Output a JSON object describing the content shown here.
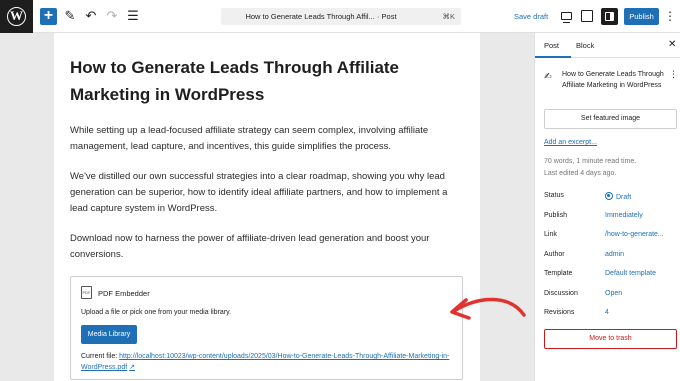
{
  "topbar": {
    "logo_letter": "W",
    "add_icon": "+",
    "pen_icon": "✎",
    "undo_icon": "↶",
    "redo_icon": "↷",
    "list_icon": "☰",
    "command_title": "How to Generate Leads Through Affil... · Post",
    "command_shortcut": "⌘K",
    "save_draft": "Save draft",
    "publish": "Publish",
    "more_icon": "⋮"
  },
  "editor": {
    "title": "How to Generate Leads Through Affiliate Marketing in WordPress",
    "paragraphs": [
      "While setting up a lead-focused affiliate strategy can seem complex, involving affiliate management, lead capture, and incentives, this guide simplifies the process.",
      "We've distilled our own successful strategies into a clear roadmap, showing you why lead generation can be superior, how to identify ideal affiliate partners, and how to implement a lead capture system in WordPress.",
      "Download now to harness the power of affiliate-driven lead generation and boost your conversions."
    ],
    "pdf_block": {
      "icon_text": "PDF",
      "title": "PDF Embedder",
      "description": "Upload a file or pick one from your media library.",
      "button": "Media Library",
      "current_file_label": "Current file: ",
      "current_file_link": "http://localhost:10023/wp-content/uploads/2025/03/How-to-Generate-Leads-Through-Affiliate-Marketing-in-WordPress.pdf",
      "external_icon": "↗"
    }
  },
  "annotation": {
    "arrow_color": "#e0332e"
  },
  "sidebar": {
    "tabs": [
      "Post",
      "Block"
    ],
    "close_icon": "✕",
    "doc_icon": "✍",
    "doc_title": "How to Generate Leads Through Affiliate Marketing in WordPress",
    "doc_more": "⋮",
    "featured_image": "Set featured image",
    "add_excerpt": "Add an excerpt...",
    "word_count": "70 words, 1 minute read time.",
    "last_edited": "Last edited 4 days ago.",
    "rows": [
      {
        "label": "Status",
        "value": "Draft"
      },
      {
        "label": "Publish",
        "value": "Immediately"
      },
      {
        "label": "Link",
        "value": "/how-to-generate..."
      },
      {
        "label": "Author",
        "value": "admin"
      },
      {
        "label": "Template",
        "value": "Default template"
      },
      {
        "label": "Discussion",
        "value": "Open"
      },
      {
        "label": "Revisions",
        "value": "4"
      }
    ],
    "trash": "Move to trash"
  },
  "colors": {
    "accent": "#1e6fb6",
    "danger": "#cc1818",
    "dark": "#1e1e1e"
  }
}
